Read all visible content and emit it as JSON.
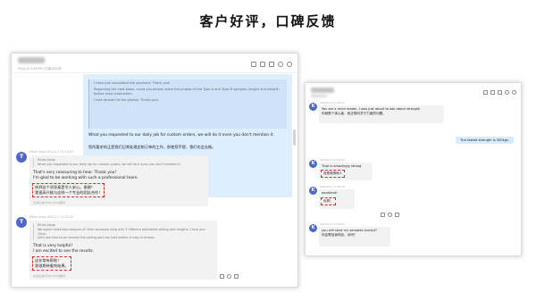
{
  "page_title": "客户好评，口碑反馈",
  "left_panel": {
    "header_meta": "2024.10 3:26 PM | 已读/2024年",
    "sent": {
      "quote_lines": [
        "I have just completed the payment. Thank you!",
        "Regarding the next steps, could you please share the photos of the Type A and Type B samples (length and weight) before mass production.",
        "I look forward to the photos. Thank you!"
      ],
      "main": "What you requested to our daily job for custom orders, we will do it even you don't mention it.",
      "cn": "您所要求的正是我们日常处理定制订单的工作，即使您不提，我们也会去做。",
      "foot": "此消息由Ethan Jiang翻译"
    },
    "msg1": {
      "avatar": "T",
      "meta": "Ethan Jiang  2024-1-7 11:14:03",
      "quote_name": "Ethan Jiang:",
      "quote": "What you requested to our daily job for custom orders, we will do it even you don't mention it.",
      "text": [
        "That's very reassuring to hear. Thank you!",
        "I'm glad to be working with such a professional team."
      ],
      "highlight": [
        "听到这个消息真是令人安心。谢谢！",
        "我很高兴能与这样一个专业的团队合作！"
      ],
      "foot": "此消息由Ethan Jiang翻译"
    },
    "msg2": {
      "avatar": "T",
      "meta": "Ethan Jiang  2024-1-7 11:23:29",
      "quote_name": "Ethan Jiang:",
      "quote": [
        "We would make two samples of 2mm whoopee sling with 2 different adjustable sliding part lengths, 10cm and 15cm.",
        "Let's see how much tension the sliding part can hold before it slips or breaks."
      ],
      "text": [
        "That is very helpful!",
        "I am excited to see the results."
      ],
      "highlight": [
        "这非常有帮助！",
        "我很期待看到结果。"
      ],
      "foot": "此消息由Ethan Jiang翻译"
    }
  },
  "right_panel": {
    "m1": {
      "avatar": "K",
      "meta": "2023-8-17 17:04:11",
      "text": "You are a mind reader, I was just about to ask about strength",
      "cn": "你就是个读心者，我正想问关于力度的问题。"
    },
    "sent": "The tested strength is 350kgs.",
    "m2": {
      "avatar": "K",
      "meta": "2023-8-17 17:05:03",
      "text": "That is amazingly strong",
      "highlight": "真是强得惊人"
    },
    "m3": {
      "avatar": "K",
      "meta": "2023-8-17 17:05:19",
      "text": "excellent!",
      "highlight": "优秀！"
    },
    "m4": {
      "avatar": "K",
      "meta": "2023-8-17 17:06:23",
      "text": "you will send my samples correct?",
      "cn": "你会寄给我样品，对吗？"
    }
  }
}
